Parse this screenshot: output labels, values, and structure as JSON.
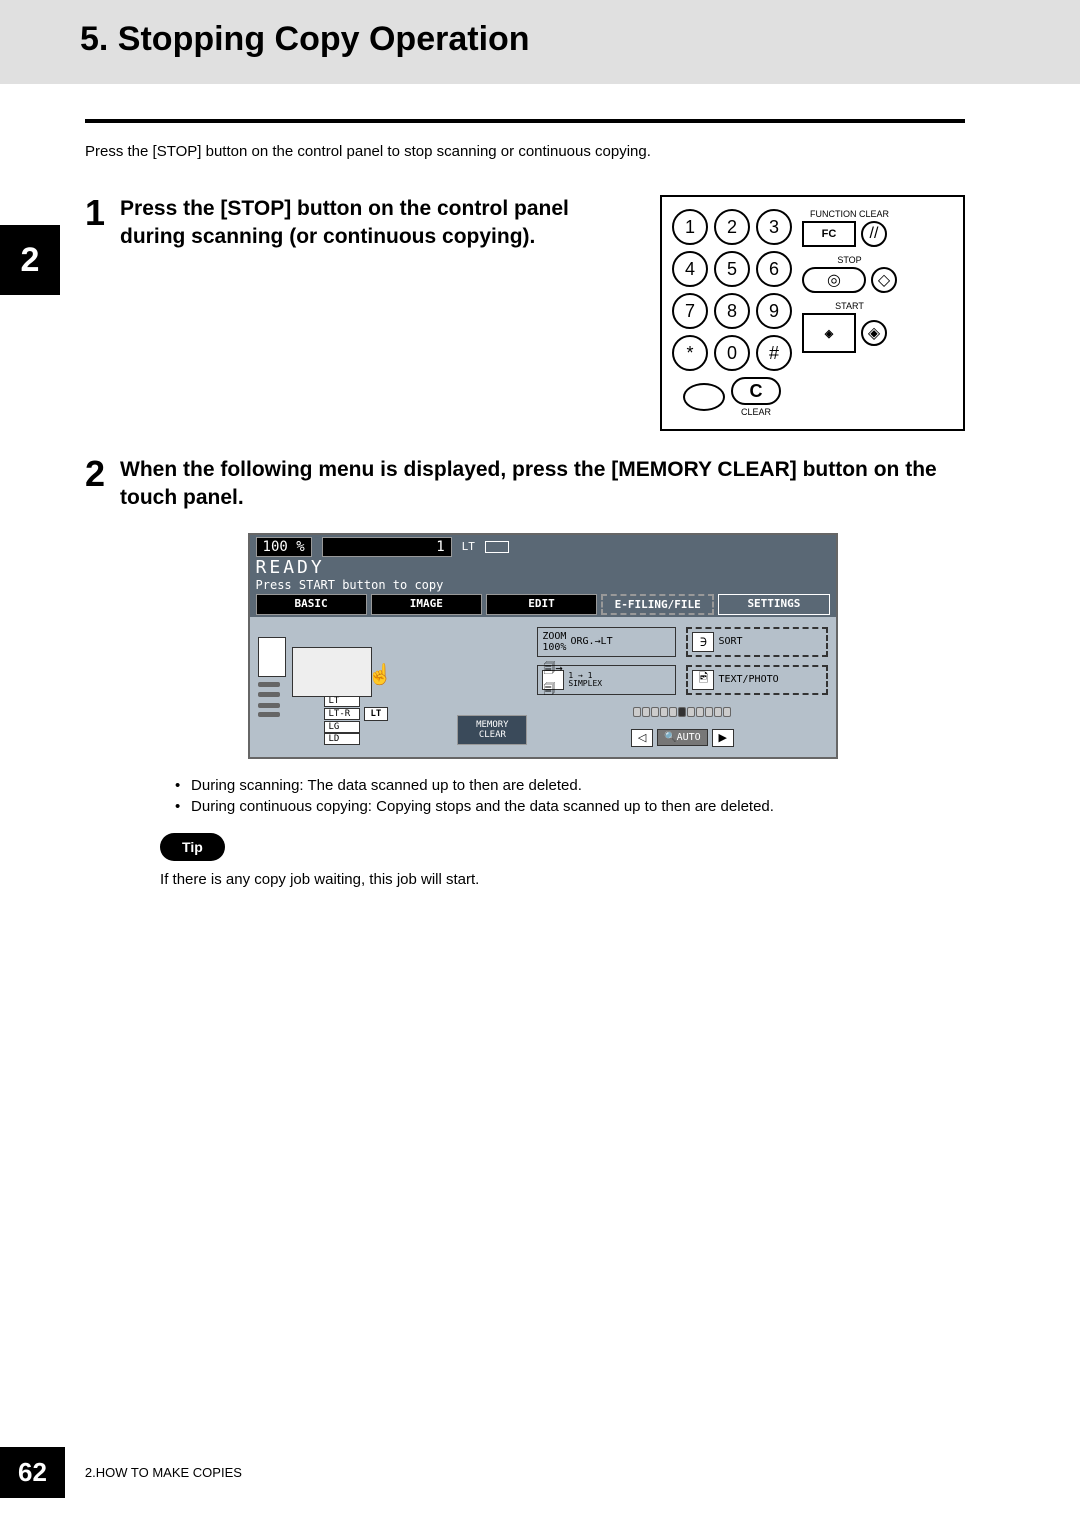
{
  "header": {
    "title": "5. Stopping Copy Operation"
  },
  "side_tab": "2",
  "intro": "Press the [STOP] button on the control panel to stop scanning or continuous copying.",
  "steps": [
    {
      "num": "1",
      "text": "Press the [STOP] button on the control panel during scanning (or continuous copying)."
    },
    {
      "num": "2",
      "text": "When the following menu is displayed, press the [MEMORY CLEAR] button on the touch panel."
    }
  ],
  "control_panel": {
    "keys": [
      "1",
      "2",
      "3",
      "4",
      "5",
      "6",
      "7",
      "8",
      "9",
      "*",
      "0",
      "#"
    ],
    "c_key": "C",
    "clear_label": "CLEAR",
    "function_clear_label": "FUNCTION CLEAR",
    "fc_label": "FC",
    "stop_label": "STOP",
    "start_label": "START",
    "stop_glyph": "◎",
    "aux1_glyph": "◇",
    "start_glyph": "◈",
    "aux2_glyph": "◈"
  },
  "touch_panel": {
    "pct": "100  %",
    "count": "1",
    "lt": "LT",
    "ready": "READY",
    "prompt": "Press START button to copy",
    "tabs": [
      "BASIC",
      "IMAGE",
      "EDIT",
      "E-FILING/FILE",
      "SETTINGS"
    ],
    "zoom_label": "ZOOM",
    "zoom_sub": "100%",
    "orig_lt": "ORG.→LT",
    "sort": "SORT",
    "simplex_top": "1 → 1",
    "simplex": "SIMPLEX",
    "text_photo": "TEXT/PHOTO",
    "memory_clear": "MEMORY CLEAR",
    "auto": "AUTO",
    "paper_sizes": [
      "LT",
      "LT-R",
      "LG",
      "LD"
    ],
    "lt_badge": "LT"
  },
  "bullets": [
    "During scanning: The data scanned up to then are deleted.",
    "During continuous copying: Copying stops and the data scanned up to then are deleted."
  ],
  "tip": {
    "badge": "Tip",
    "text": "If there is any copy job waiting, this job will start."
  },
  "footer": {
    "page": "62",
    "chapter": "2.HOW TO MAKE COPIES"
  }
}
